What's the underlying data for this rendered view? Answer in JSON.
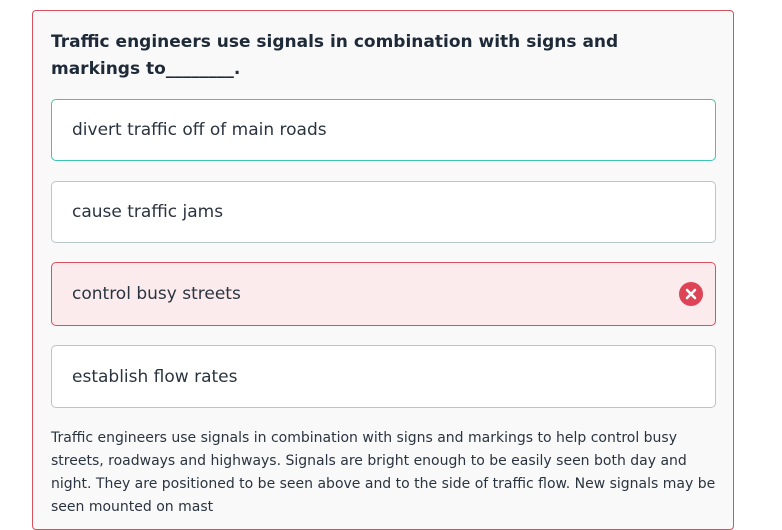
{
  "question": {
    "text": "Traffic engineers use signals in combination with signs and markings to________."
  },
  "options": [
    {
      "label": "divert traffic off of main roads",
      "state": "highlighted"
    },
    {
      "label": "cause traffic jams",
      "state": "default"
    },
    {
      "label": "control busy streets",
      "state": "incorrect",
      "icon": "x-circle-icon"
    },
    {
      "label": "establish flow rates",
      "state": "default"
    }
  ],
  "explanation": {
    "text": "Traffic engineers use signals in combination with signs and markings to help control busy streets, roadways and highways. Signals are bright enough to be easily seen both day and night. They are positioned to be seen above and to the side of traffic flow. New signals may be seen mounted on mast"
  },
  "colors": {
    "card_border": "#d9505e",
    "highlight_border": "#3fc7ad",
    "incorrect_bg": "#fcebec",
    "incorrect_icon": "#dd4455"
  }
}
